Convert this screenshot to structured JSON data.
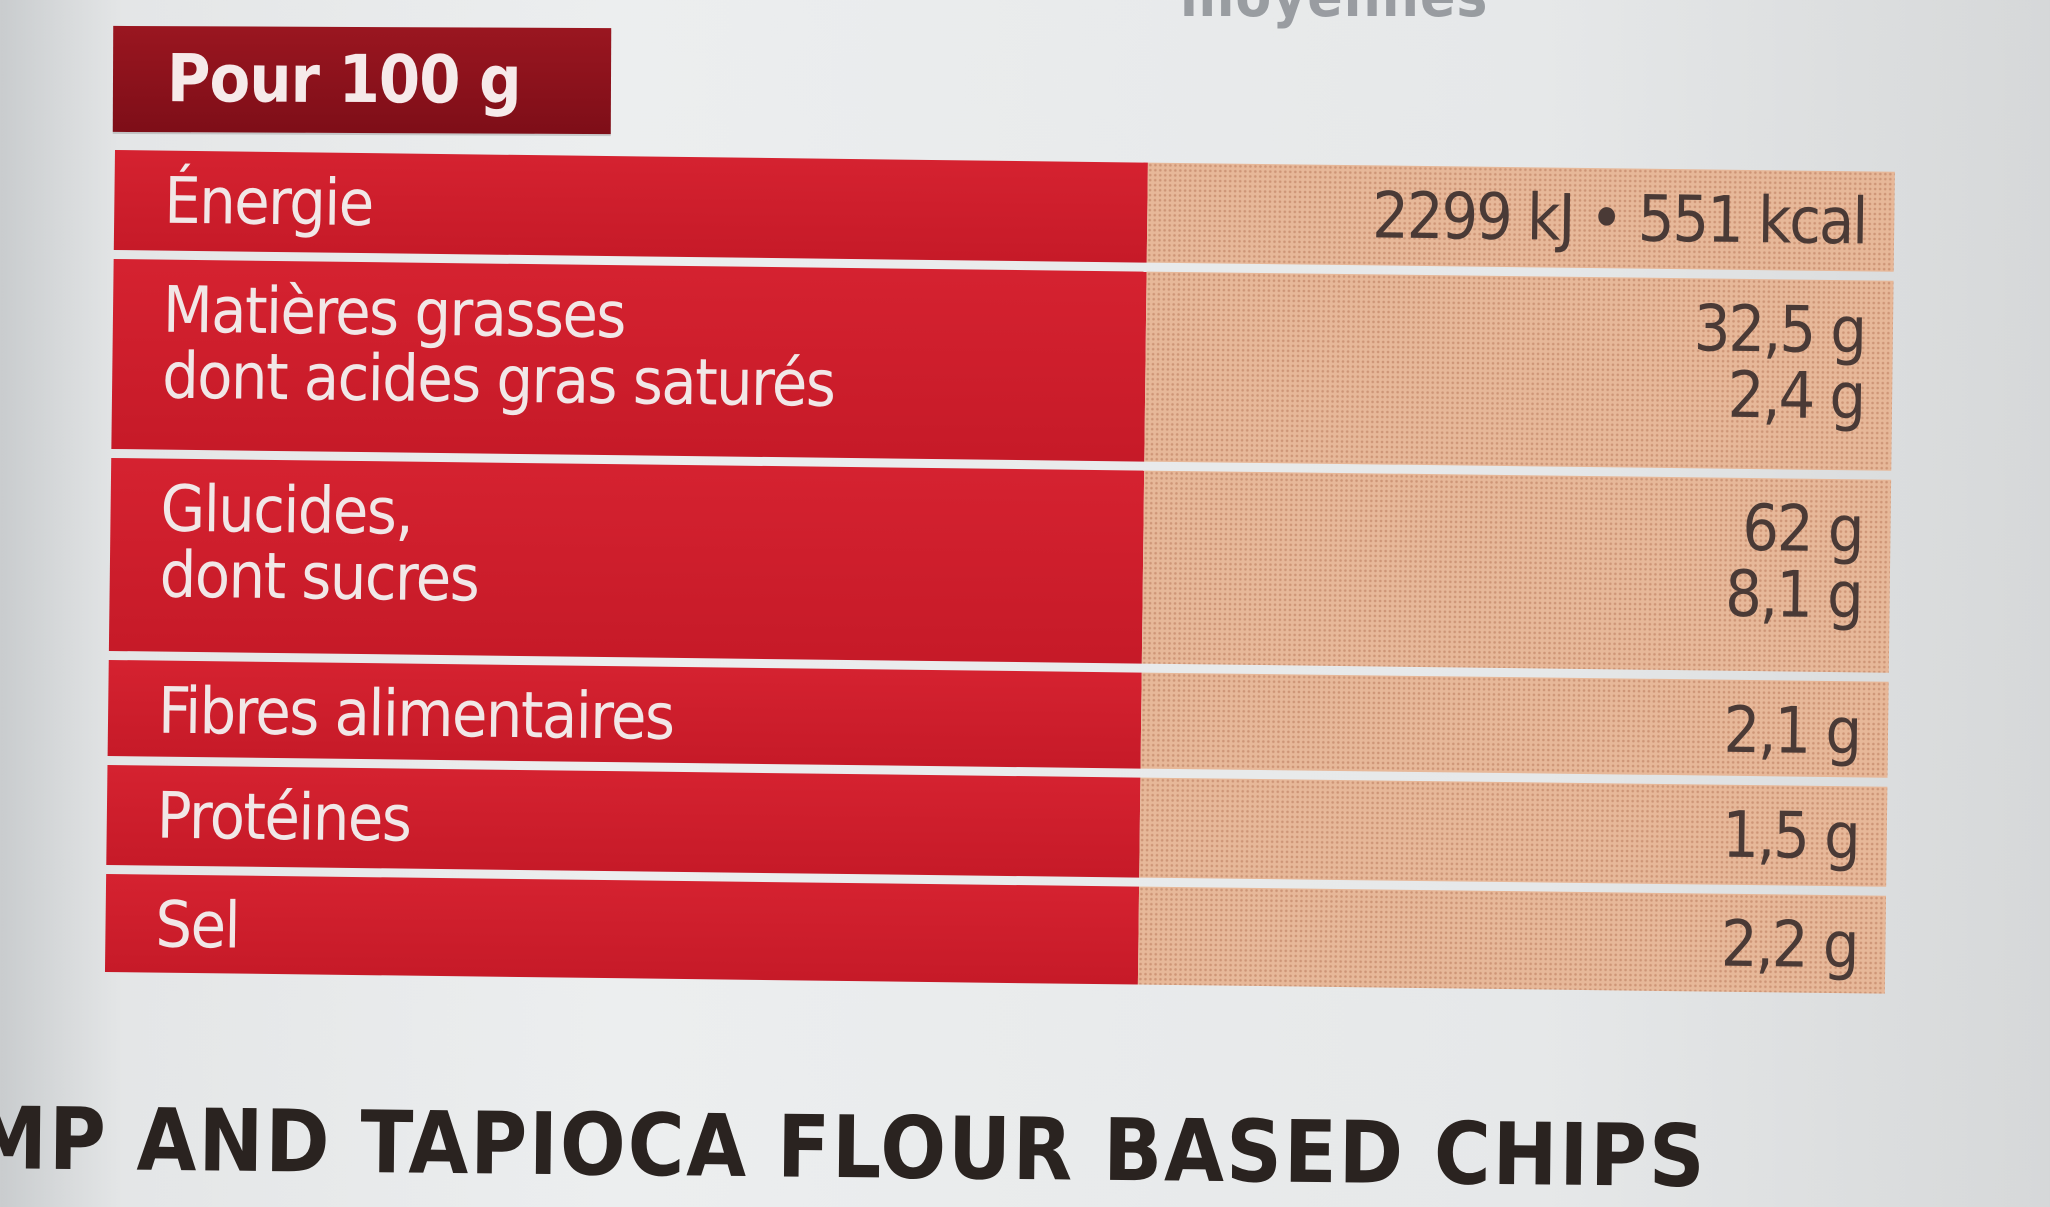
{
  "top_fragment": "moyennes",
  "header": {
    "label": "Pour 100 g"
  },
  "rows": [
    {
      "label": [
        "Énergie"
      ],
      "value": [
        "2299 kJ • 551 kcal"
      ]
    },
    {
      "label": [
        "Matières grasses",
        "dont acides gras saturés"
      ],
      "value": [
        "32,5 g",
        "2,4 g"
      ]
    },
    {
      "label": [
        "Glucides,",
        "dont sucres"
      ],
      "value": [
        "62 g",
        "8,1 g"
      ]
    },
    {
      "label": [
        "Fibres alimentaires"
      ],
      "value": [
        "2,1 g"
      ]
    },
    {
      "label": [
        "Protéines"
      ],
      "value": [
        "1,5 g"
      ]
    },
    {
      "label": [
        "Sel"
      ],
      "value": [
        "2,2 g"
      ]
    }
  ],
  "bottom_text": "MP AND TAPIOCA FLOUR BASED CHIPS",
  "colors": {
    "label_bg": "#c91c2a",
    "value_bg": "#e7b899",
    "header_bg": "#8a111b"
  }
}
